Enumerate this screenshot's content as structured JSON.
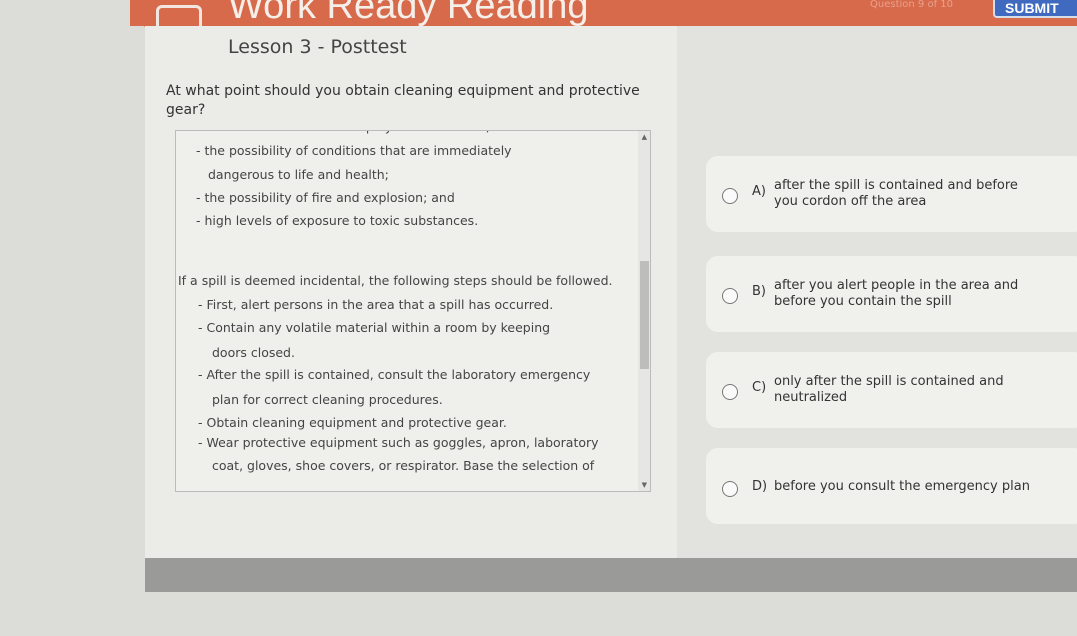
{
  "header": {
    "app_title": "Work Ready Reading",
    "question_counter": "Question 9 of 10",
    "submit_label": "SUBMIT",
    "accent": "#d86a4c"
  },
  "lesson_title": "Lesson 3 - Posttest",
  "question": "At what point should you obtain cleaning equipment and protective gear?",
  "passage": [
    "the need to evacuate employees in the area;",
    "-  the possibility of conditions that are immediately",
    "dangerous to life and health;",
    "-  the possibility of fire and explosion; and",
    "-  high levels of exposure to toxic substances.",
    "If a spill is deemed incidental, the following steps should be followed.",
    "-  First, alert persons in the area that a spill has occurred.",
    "-  Contain any volatile material within a room by keeping",
    "doors closed.",
    "-  After the spill is contained, consult the laboratory emergency",
    "plan for correct cleaning procedures.",
    "-  Obtain cleaning equipment and protective gear.",
    "-  Wear protective equipment such as goggles, apron, laboratory",
    "coat, gloves, shoe covers, or respirator. Base the selection of"
  ],
  "options": [
    {
      "letter": "A)",
      "text": "after the spill is contained and before you cordon off the area"
    },
    {
      "letter": "B)",
      "text": "after you alert people in the area and before you contain the spill"
    },
    {
      "letter": "C)",
      "text": "only after the spill is contained and neutralized"
    },
    {
      "letter": "D)",
      "text": "before you consult the emergency plan"
    }
  ]
}
